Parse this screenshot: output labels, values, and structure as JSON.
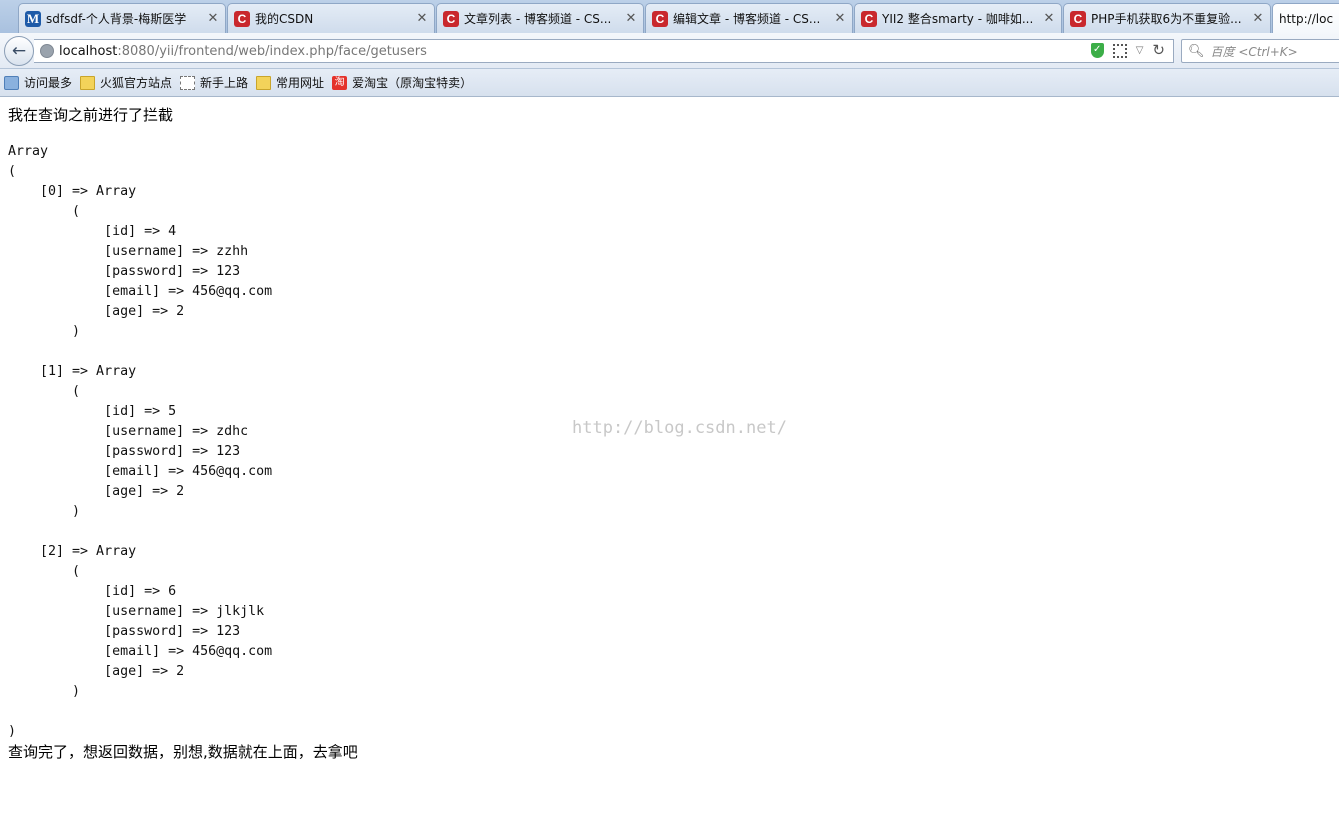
{
  "browser": {
    "tabs": [
      {
        "icon": "M",
        "icon_type": "m",
        "title": "sdfsdf-个人背景-梅斯医学"
      },
      {
        "icon": "C",
        "icon_type": "c",
        "title": "我的CSDN"
      },
      {
        "icon": "C",
        "icon_type": "c",
        "title": "文章列表 - 博客频道 - CS..."
      },
      {
        "icon": "C",
        "icon_type": "c",
        "title": "编辑文章 - 博客频道 - CS..."
      },
      {
        "icon": "C",
        "icon_type": "c",
        "title": "YII2 整合smarty - 咖啡如..."
      },
      {
        "icon": "C",
        "icon_type": "c",
        "title": "PHP手机获取6为不重复验..."
      },
      {
        "icon": "",
        "icon_type": "",
        "title": "http://loc"
      }
    ],
    "url_host": "localhost",
    "url_rest": ":8080/yii/frontend/web/index.php/face/getusers",
    "search_placeholder": "百度 <Ctrl+K>",
    "bookmarks": [
      {
        "icon": "star",
        "label": "访问最多"
      },
      {
        "icon": "folder",
        "label": "火狐官方站点"
      },
      {
        "icon": "dashed",
        "label": "新手上路"
      },
      {
        "icon": "folder",
        "label": "常用网址"
      },
      {
        "icon": "tao",
        "icon_text": "淘",
        "label": "爱淘宝（原淘宝特卖）"
      }
    ]
  },
  "page": {
    "intercept_message": "我在查询之前进行了拦截",
    "dump_text": "Array\n(\n    [0] => Array\n        (\n            [id] => 4\n            [username] => zzhh\n            [password] => 123\n            [email] => 456@qq.com\n            [age] => 2\n        )\n\n    [1] => Array\n        (\n            [id] => 5\n            [username] => zdhc\n            [password] => 123\n            [email] => 456@qq.com\n            [age] => 2\n        )\n\n    [2] => Array\n        (\n            [id] => 6\n            [username] => jlkjlk\n            [password] => 123\n            [email] => 456@qq.com\n            [age] => 2\n        )\n\n)",
    "done_message": "查询完了，想返回数据，别想,数据就在上面，去拿吧",
    "watermark": "http://blog.csdn.net/"
  }
}
